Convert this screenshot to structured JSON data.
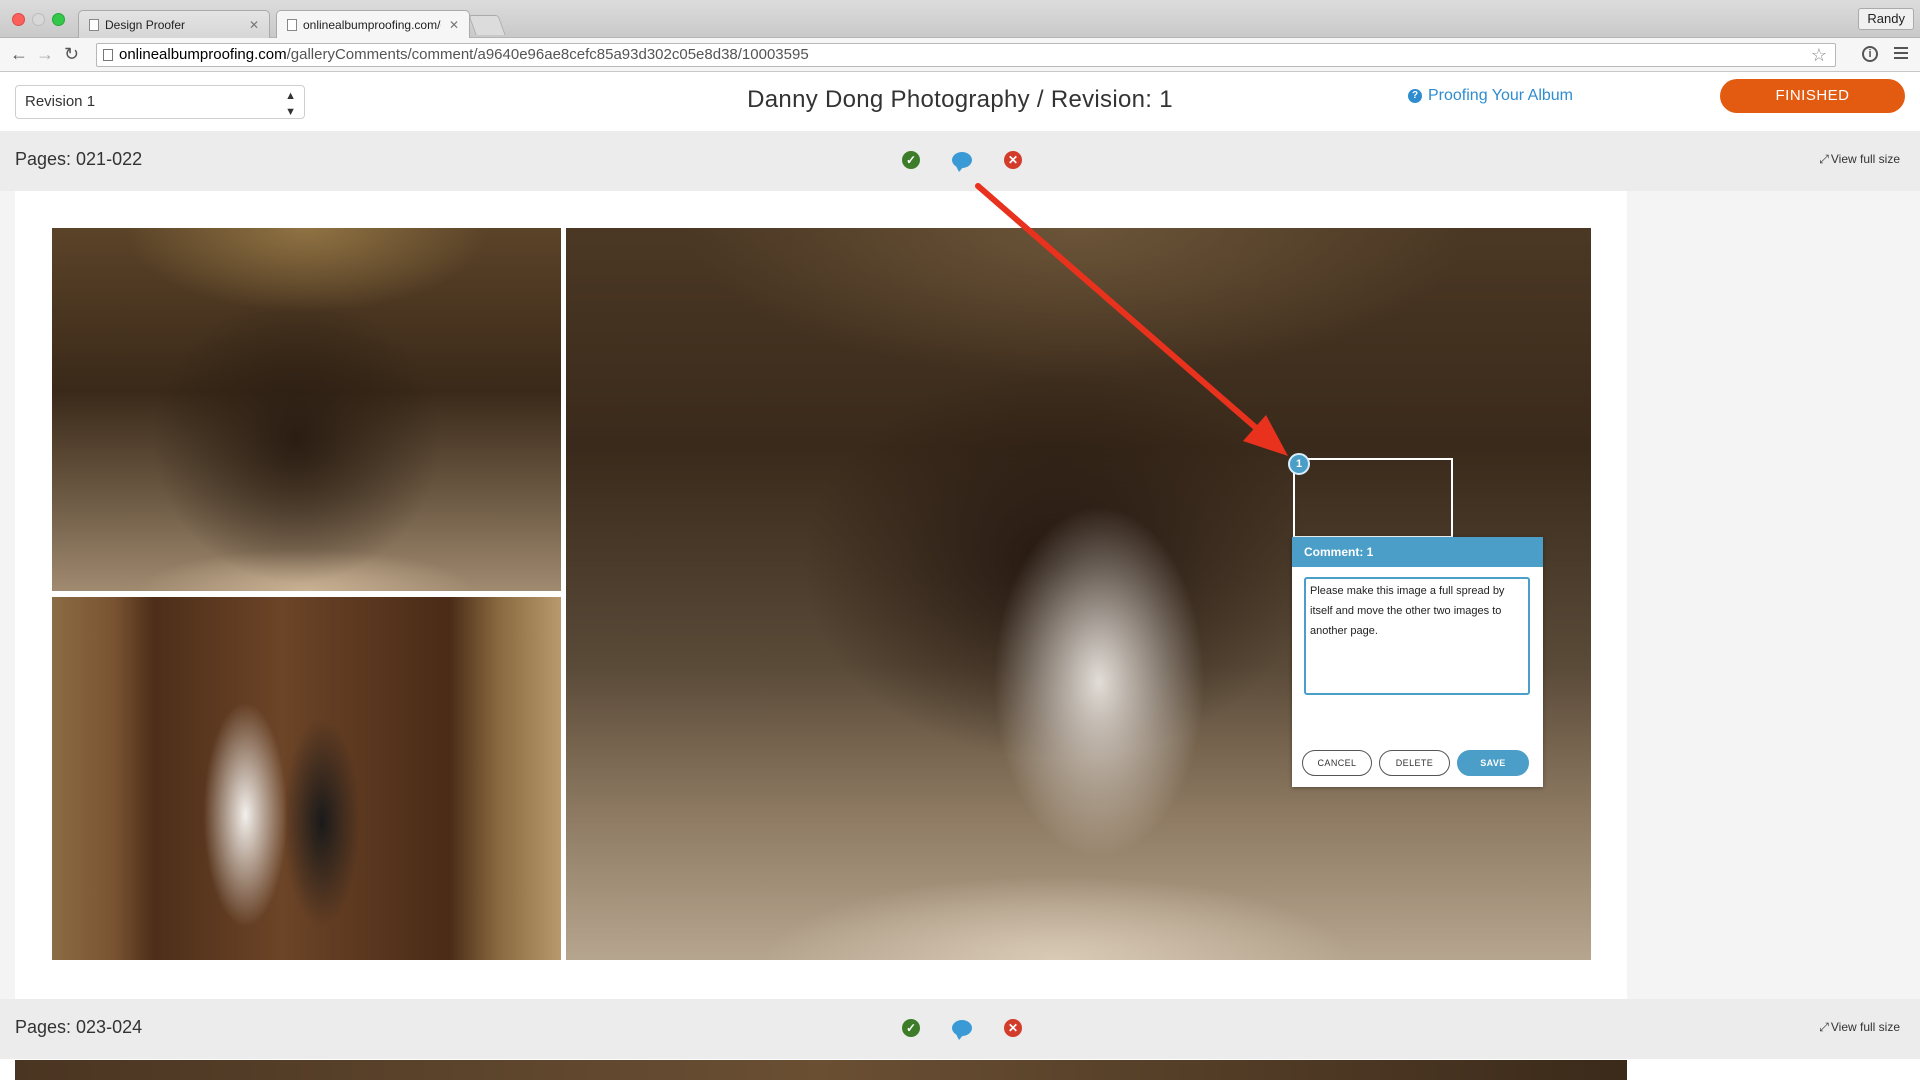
{
  "browser": {
    "tabs": [
      {
        "title": "Design Proofer",
        "active": false
      },
      {
        "title": "onlinealbumproofing.com/g",
        "active": true
      }
    ],
    "profile": "Randy",
    "url_host": "onlinealbumproofing.com",
    "url_path": "/galleryComments/comment/a9640e96ae8cefc85a93d302c05e8d38/10003595"
  },
  "header": {
    "revision_select": "Revision 1",
    "title": "Danny Dong Photography / Revision: 1",
    "help_link": "Proofing Your Album",
    "finished_button": "FINISHED"
  },
  "sections": [
    {
      "pages": "Pages: 021-022",
      "view_full": "View full size"
    },
    {
      "pages": "Pages: 023-024",
      "view_full": "View full size"
    }
  ],
  "comment": {
    "pin_number": "1",
    "header": "Comment: 1",
    "text": "Please make this image a full spread by itself and move the other two images to another page.",
    "cancel": "CANCEL",
    "delete": "DELETE",
    "save": "SAVE"
  },
  "icons": {
    "approve": "check-circle-icon",
    "comment": "speech-bubble-icon",
    "reject": "x-circle-icon"
  },
  "colors": {
    "accent_orange": "#e25b11",
    "link_blue": "#2f8ccf",
    "comment_blue": "#4a9ec8",
    "approve_green": "#3d7d2a",
    "reject_red": "#d33c2b",
    "arrow_red": "#e8321e"
  }
}
